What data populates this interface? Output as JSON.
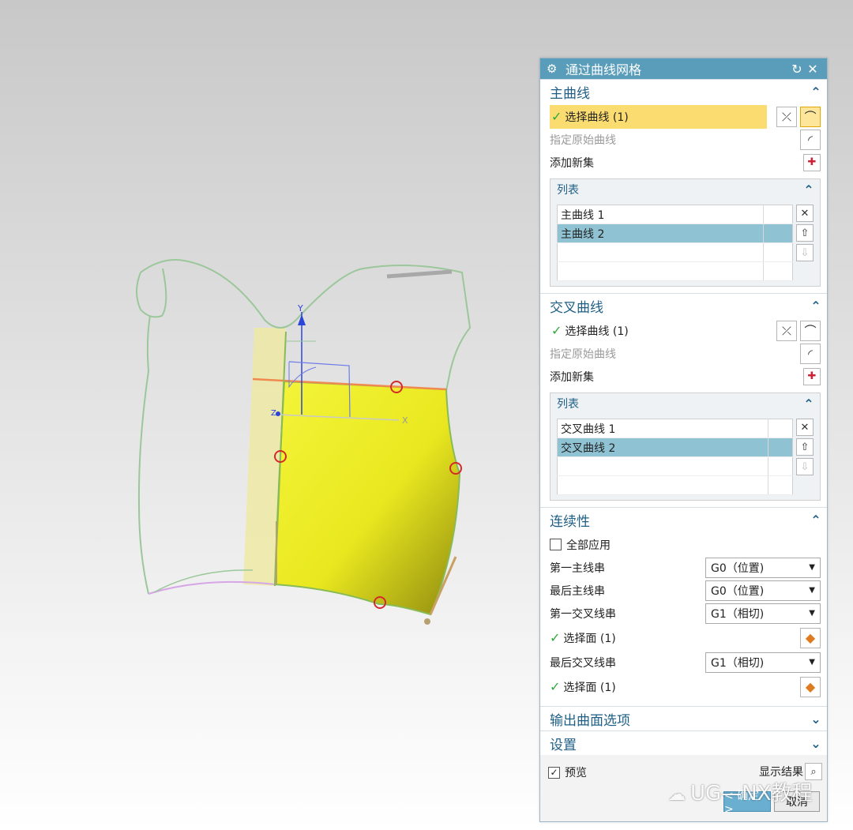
{
  "dialog": {
    "title": "通过曲线网格",
    "icons": {
      "settings": "gear-icon",
      "reset": "reset-icon",
      "close": "close-icon"
    }
  },
  "primary_curves": {
    "header": "主曲线",
    "select_label": "选择曲线 (1)",
    "original_label": "指定原始曲线",
    "add_set_label": "添加新集",
    "list_header": "列表",
    "list_items": [
      "主曲线 1",
      "主曲线 2"
    ],
    "selected_index": 1
  },
  "cross_curves": {
    "header": "交叉曲线",
    "select_label": "选择曲线 (1)",
    "original_label": "指定原始曲线",
    "add_set_label": "添加新集",
    "list_header": "列表",
    "list_items": [
      "交叉曲线 1",
      "交叉曲线 2"
    ],
    "selected_index": 1
  },
  "continuity": {
    "header": "连续性",
    "apply_all_label": "全部应用",
    "apply_all_checked": false,
    "first_primary_label": "第一主线串",
    "first_primary_value": "G0（位置)",
    "last_primary_label": "最后主线串",
    "last_primary_value": "G0（位置)",
    "first_cross_label": "第一交叉线串",
    "first_cross_value": "G1（相切)",
    "first_cross_face_label": "选择面 (1)",
    "last_cross_label": "最后交叉线串",
    "last_cross_value": "G1（相切)",
    "last_cross_face_label": "选择面 (1)"
  },
  "output_options": {
    "header": "输出曲面选项"
  },
  "settings": {
    "header": "设置"
  },
  "footer": {
    "preview_label": "预览",
    "preview_checked": true,
    "show_result_label": "显示结果",
    "ok_label": "< 确定 >",
    "cancel_label": "取消"
  },
  "viewport": {
    "axis_y": "Y",
    "axis_x": "X",
    "axis_z": "Z",
    "surface_color": "#f2f230"
  },
  "watermark": "UG—NX教程"
}
